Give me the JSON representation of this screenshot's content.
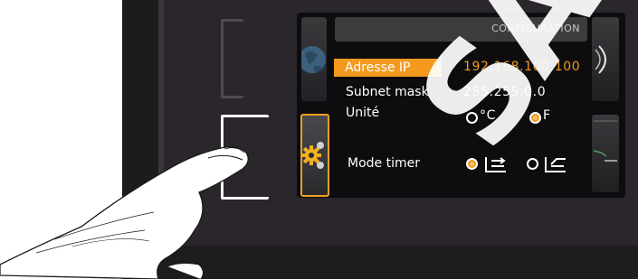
{
  "screen": {
    "header_title": "CONFIGURATION",
    "settings": {
      "ip_label": "Adresse IP",
      "ip_value": "192.168.100.100",
      "subnet_label": "Subnet mask",
      "subnet_value": "255.255.0.0",
      "unit_label": "Unité",
      "unit_option_c": "°C",
      "unit_option_f": "F",
      "unit_selected": "F",
      "timer_label": "Mode timer",
      "timer_selected": "mode-1"
    },
    "side_buttons": {
      "left_top_icon": "globe-icon",
      "left_bottom_icon": "gear-icon",
      "right_top_icon": "moon-icon",
      "right_bottom_icon": "wave-icon"
    }
  },
  "watermark": "SAS",
  "colors": {
    "accent": "#f39a1e",
    "screen_bg": "#0d0d0f",
    "device_bg": "#2a262b"
  }
}
